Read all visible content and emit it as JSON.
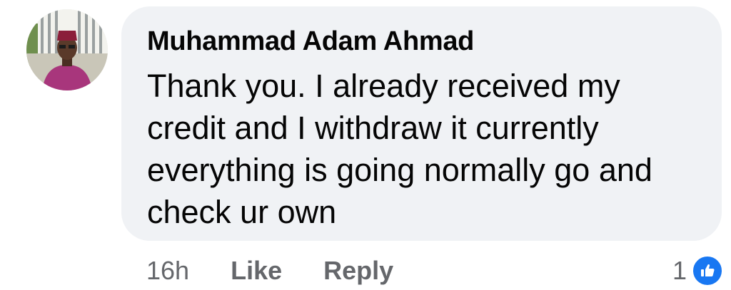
{
  "comment": {
    "author": "Muhammad Adam Ahmad",
    "text": "Thank you. I already received my credit and I withdraw it currently everything is going normally go and check ur own",
    "timestamp": "16h",
    "like_label": "Like",
    "reply_label": "Reply",
    "reaction_count": "1",
    "reaction_icon": "thumbs-up-icon"
  },
  "colors": {
    "bubble_background": "#f0f2f5",
    "text": "#050505",
    "secondary_text": "#65676b",
    "like_blue": "#1877f2"
  }
}
